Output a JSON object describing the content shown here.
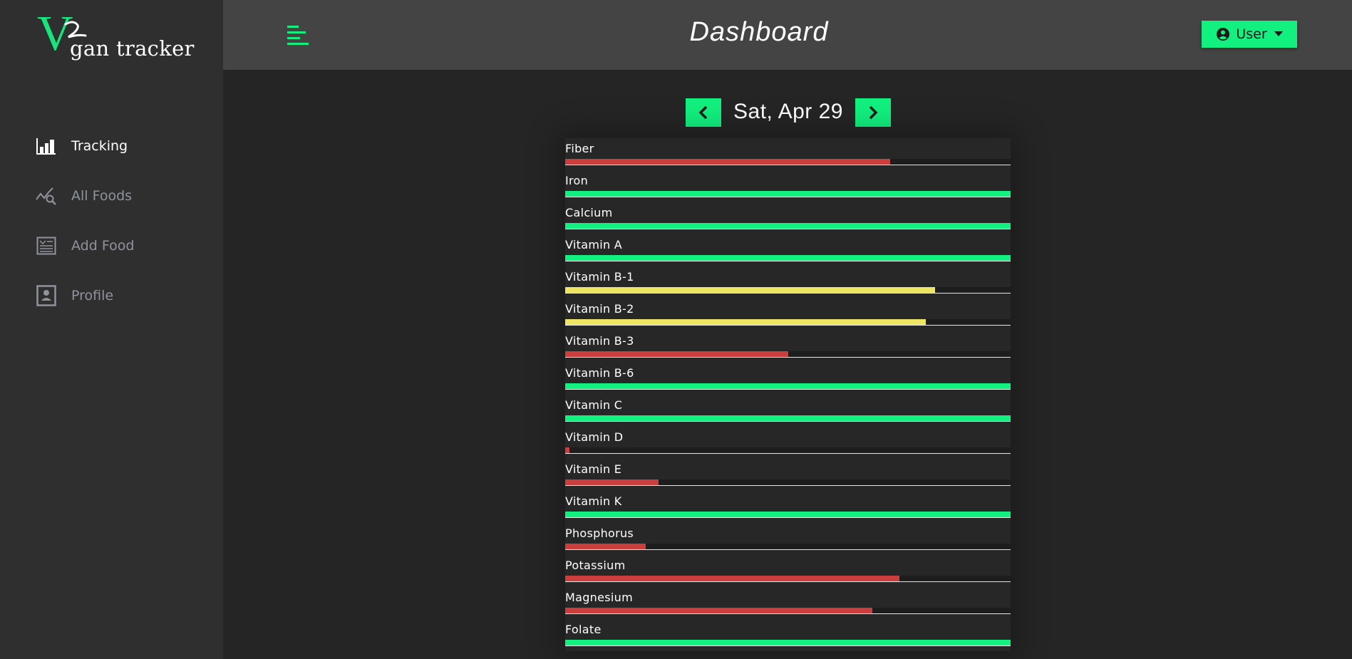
{
  "app": {
    "logo_letter": "V",
    "logo_text": "gan tracker"
  },
  "sidebar": {
    "items": [
      {
        "label": "Tracking",
        "icon": "bar-chart-icon",
        "active": true
      },
      {
        "label": "All Foods",
        "icon": "chart-search-icon",
        "active": false
      },
      {
        "label": "Add Food",
        "icon": "document-list-icon",
        "active": false
      },
      {
        "label": "Profile",
        "icon": "profile-card-icon",
        "active": false
      }
    ]
  },
  "header": {
    "title": "Dashboard",
    "user_label": "User"
  },
  "date_nav": {
    "date": "Sat, Apr 29"
  },
  "colors": {
    "accent": "#12f07f",
    "low": "#cc3d3d",
    "medium": "#efe565",
    "good": "#12f07f"
  },
  "nutrients": [
    {
      "name": "Fiber",
      "level": 0.73,
      "status": "low"
    },
    {
      "name": "Iron",
      "level": 1.0,
      "status": "good"
    },
    {
      "name": "Calcium",
      "level": 1.0,
      "status": "good"
    },
    {
      "name": "Vitamin A",
      "level": 1.0,
      "status": "good"
    },
    {
      "name": "Vitamin B-1",
      "level": 0.83,
      "status": "medium"
    },
    {
      "name": "Vitamin B-2",
      "level": 0.81,
      "status": "medium"
    },
    {
      "name": "Vitamin B-3",
      "level": 0.5,
      "status": "low"
    },
    {
      "name": "Vitamin B-6",
      "level": 1.0,
      "status": "good"
    },
    {
      "name": "Vitamin C",
      "level": 1.0,
      "status": "good"
    },
    {
      "name": "Vitamin D",
      "level": 0.01,
      "status": "low"
    },
    {
      "name": "Vitamin E",
      "level": 0.21,
      "status": "low"
    },
    {
      "name": "Vitamin K",
      "level": 1.0,
      "status": "good"
    },
    {
      "name": "Phosphorus",
      "level": 0.18,
      "status": "low"
    },
    {
      "name": "Potassium",
      "level": 0.75,
      "status": "low"
    },
    {
      "name": "Magnesium",
      "level": 0.69,
      "status": "low"
    },
    {
      "name": "Folate",
      "level": 1.0,
      "status": "good"
    }
  ]
}
